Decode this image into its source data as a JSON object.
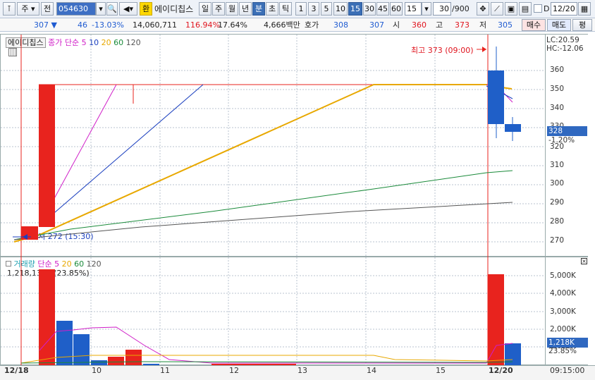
{
  "toolbar": {
    "market": "주",
    "prev": "전",
    "code": "054630",
    "name": "에이디칩스",
    "exchange": "환",
    "periods": [
      "일",
      "주",
      "월",
      "년",
      "분",
      "초",
      "틱"
    ],
    "minutes": [
      "1",
      "3",
      "5",
      "10",
      "15",
      "30",
      "45",
      "60"
    ],
    "interval": "15",
    "count": "30",
    "count_max": "/900",
    "date": "12/20",
    "date_check": "D"
  },
  "quote": {
    "price": "307",
    "change": "46",
    "change_pct": "-13.03%",
    "volume": "14,060,711",
    "vol_ratio": "116.94%",
    "turnover": "17.64%",
    "amount": "4,666백만",
    "hoga_label": "호가",
    "hoga_ask": "308",
    "hoga_bid": "307",
    "open_label": "시",
    "open": "360",
    "high_label": "고",
    "high": "373",
    "low_label": "저",
    "low": "305",
    "buy": "매수",
    "sell": "매도",
    "pyeong": "평"
  },
  "price_pane": {
    "title": "에이디칩스",
    "legend_label": "종가 단순",
    "ma": [
      "5",
      "10",
      "20",
      "60",
      "120"
    ],
    "high_note": "최고 373 (09:00)",
    "low_note": "최저 272 (15:30)",
    "lc": "LC:20.59",
    "hc": "HC:-12.06",
    "current": "328",
    "current_pct": "-1.20%",
    "y_ticks": [
      "360",
      "350",
      "340",
      "330",
      "320",
      "310",
      "300",
      "290",
      "280",
      "270"
    ]
  },
  "volume_pane": {
    "legend_label": "거래량",
    "legend_simple": "단순",
    "ma": [
      "5",
      "20",
      "60",
      "120"
    ],
    "value_note": "1,218,137주(23.85%)",
    "current": "1,218K",
    "current_pct": "23.85%",
    "y_ticks": [
      "5,000K",
      "4,000K",
      "3,000K",
      "2,000K",
      "1,000K"
    ]
  },
  "x_axis": {
    "labels": [
      "12/18",
      "10",
      "11",
      "12",
      "13",
      "14",
      "15",
      "12/20"
    ],
    "time": "09:15:00"
  },
  "colors": {
    "up": "#e8231e",
    "down": "#1f5fc8",
    "ma5": "#d01ec8",
    "ma10": "#1a3fbf",
    "ma20": "#e8a800",
    "ma60": "#1a8a3a",
    "ma120": "#555555"
  }
}
